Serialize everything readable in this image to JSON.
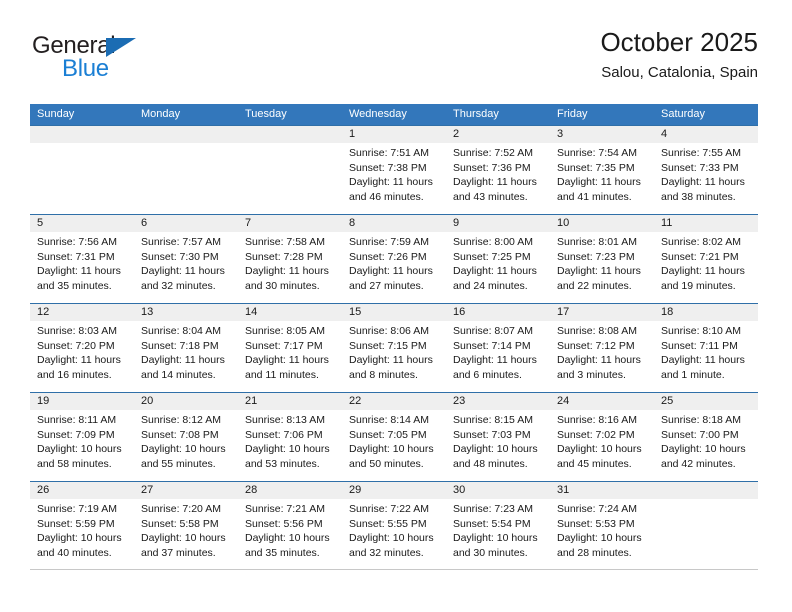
{
  "brand": {
    "name_part1": "General",
    "name_part2": "Blue",
    "color_dark": "#231f20",
    "color_blue": "#1b7fd4",
    "triangle_color": "#1b6cb3"
  },
  "header": {
    "title": "October 2025",
    "subtitle": "Salou, Catalonia, Spain"
  },
  "theme": {
    "header_row_bg": "#3377bb",
    "week_divider": "#2f6fa8",
    "date_band_bg": "#efefef",
    "text": "#1a1a1a"
  },
  "weekdays": [
    {
      "label": "Sunday"
    },
    {
      "label": "Monday"
    },
    {
      "label": "Tuesday"
    },
    {
      "label": "Wednesday"
    },
    {
      "label": "Thursday"
    },
    {
      "label": "Friday"
    },
    {
      "label": "Saturday"
    }
  ],
  "weeks": [
    {
      "days": [
        {
          "date": "",
          "lines": []
        },
        {
          "date": "",
          "lines": []
        },
        {
          "date": "",
          "lines": []
        },
        {
          "date": "1",
          "lines": [
            "Sunrise: 7:51 AM",
            "Sunset: 7:38 PM",
            "Daylight: 11 hours",
            "and 46 minutes."
          ]
        },
        {
          "date": "2",
          "lines": [
            "Sunrise: 7:52 AM",
            "Sunset: 7:36 PM",
            "Daylight: 11 hours",
            "and 43 minutes."
          ]
        },
        {
          "date": "3",
          "lines": [
            "Sunrise: 7:54 AM",
            "Sunset: 7:35 PM",
            "Daylight: 11 hours",
            "and 41 minutes."
          ]
        },
        {
          "date": "4",
          "lines": [
            "Sunrise: 7:55 AM",
            "Sunset: 7:33 PM",
            "Daylight: 11 hours",
            "and 38 minutes."
          ]
        }
      ]
    },
    {
      "days": [
        {
          "date": "5",
          "lines": [
            "Sunrise: 7:56 AM",
            "Sunset: 7:31 PM",
            "Daylight: 11 hours",
            "and 35 minutes."
          ]
        },
        {
          "date": "6",
          "lines": [
            "Sunrise: 7:57 AM",
            "Sunset: 7:30 PM",
            "Daylight: 11 hours",
            "and 32 minutes."
          ]
        },
        {
          "date": "7",
          "lines": [
            "Sunrise: 7:58 AM",
            "Sunset: 7:28 PM",
            "Daylight: 11 hours",
            "and 30 minutes."
          ]
        },
        {
          "date": "8",
          "lines": [
            "Sunrise: 7:59 AM",
            "Sunset: 7:26 PM",
            "Daylight: 11 hours",
            "and 27 minutes."
          ]
        },
        {
          "date": "9",
          "lines": [
            "Sunrise: 8:00 AM",
            "Sunset: 7:25 PM",
            "Daylight: 11 hours",
            "and 24 minutes."
          ]
        },
        {
          "date": "10",
          "lines": [
            "Sunrise: 8:01 AM",
            "Sunset: 7:23 PM",
            "Daylight: 11 hours",
            "and 22 minutes."
          ]
        },
        {
          "date": "11",
          "lines": [
            "Sunrise: 8:02 AM",
            "Sunset: 7:21 PM",
            "Daylight: 11 hours",
            "and 19 minutes."
          ]
        }
      ]
    },
    {
      "days": [
        {
          "date": "12",
          "lines": [
            "Sunrise: 8:03 AM",
            "Sunset: 7:20 PM",
            "Daylight: 11 hours",
            "and 16 minutes."
          ]
        },
        {
          "date": "13",
          "lines": [
            "Sunrise: 8:04 AM",
            "Sunset: 7:18 PM",
            "Daylight: 11 hours",
            "and 14 minutes."
          ]
        },
        {
          "date": "14",
          "lines": [
            "Sunrise: 8:05 AM",
            "Sunset: 7:17 PM",
            "Daylight: 11 hours",
            "and 11 minutes."
          ]
        },
        {
          "date": "15",
          "lines": [
            "Sunrise: 8:06 AM",
            "Sunset: 7:15 PM",
            "Daylight: 11 hours",
            "and 8 minutes."
          ]
        },
        {
          "date": "16",
          "lines": [
            "Sunrise: 8:07 AM",
            "Sunset: 7:14 PM",
            "Daylight: 11 hours",
            "and 6 minutes."
          ]
        },
        {
          "date": "17",
          "lines": [
            "Sunrise: 8:08 AM",
            "Sunset: 7:12 PM",
            "Daylight: 11 hours",
            "and 3 minutes."
          ]
        },
        {
          "date": "18",
          "lines": [
            "Sunrise: 8:10 AM",
            "Sunset: 7:11 PM",
            "Daylight: 11 hours",
            "and 1 minute."
          ]
        }
      ]
    },
    {
      "days": [
        {
          "date": "19",
          "lines": [
            "Sunrise: 8:11 AM",
            "Sunset: 7:09 PM",
            "Daylight: 10 hours",
            "and 58 minutes."
          ]
        },
        {
          "date": "20",
          "lines": [
            "Sunrise: 8:12 AM",
            "Sunset: 7:08 PM",
            "Daylight: 10 hours",
            "and 55 minutes."
          ]
        },
        {
          "date": "21",
          "lines": [
            "Sunrise: 8:13 AM",
            "Sunset: 7:06 PM",
            "Daylight: 10 hours",
            "and 53 minutes."
          ]
        },
        {
          "date": "22",
          "lines": [
            "Sunrise: 8:14 AM",
            "Sunset: 7:05 PM",
            "Daylight: 10 hours",
            "and 50 minutes."
          ]
        },
        {
          "date": "23",
          "lines": [
            "Sunrise: 8:15 AM",
            "Sunset: 7:03 PM",
            "Daylight: 10 hours",
            "and 48 minutes."
          ]
        },
        {
          "date": "24",
          "lines": [
            "Sunrise: 8:16 AM",
            "Sunset: 7:02 PM",
            "Daylight: 10 hours",
            "and 45 minutes."
          ]
        },
        {
          "date": "25",
          "lines": [
            "Sunrise: 8:18 AM",
            "Sunset: 7:00 PM",
            "Daylight: 10 hours",
            "and 42 minutes."
          ]
        }
      ]
    },
    {
      "days": [
        {
          "date": "26",
          "lines": [
            "Sunrise: 7:19 AM",
            "Sunset: 5:59 PM",
            "Daylight: 10 hours",
            "and 40 minutes."
          ]
        },
        {
          "date": "27",
          "lines": [
            "Sunrise: 7:20 AM",
            "Sunset: 5:58 PM",
            "Daylight: 10 hours",
            "and 37 minutes."
          ]
        },
        {
          "date": "28",
          "lines": [
            "Sunrise: 7:21 AM",
            "Sunset: 5:56 PM",
            "Daylight: 10 hours",
            "and 35 minutes."
          ]
        },
        {
          "date": "29",
          "lines": [
            "Sunrise: 7:22 AM",
            "Sunset: 5:55 PM",
            "Daylight: 10 hours",
            "and 32 minutes."
          ]
        },
        {
          "date": "30",
          "lines": [
            "Sunrise: 7:23 AM",
            "Sunset: 5:54 PM",
            "Daylight: 10 hours",
            "and 30 minutes."
          ]
        },
        {
          "date": "31",
          "lines": [
            "Sunrise: 7:24 AM",
            "Sunset: 5:53 PM",
            "Daylight: 10 hours",
            "and 28 minutes."
          ]
        },
        {
          "date": "",
          "lines": []
        }
      ]
    }
  ]
}
